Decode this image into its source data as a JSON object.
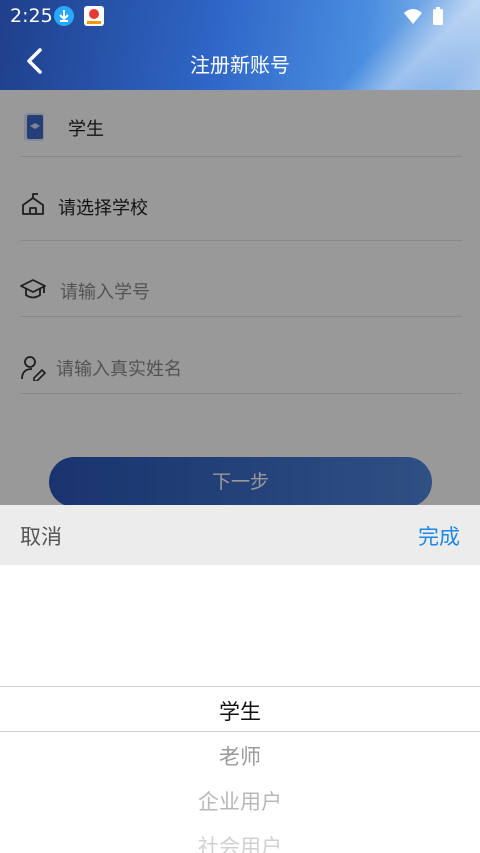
{
  "status": {
    "time": "2:25"
  },
  "header": {
    "title": "注册新账号"
  },
  "form": {
    "role_value": "学生",
    "school_placeholder": "请选择学校",
    "student_id_placeholder": "请输入学号",
    "name_placeholder": "请输入真实姓名",
    "next_label": "下一步"
  },
  "picker": {
    "cancel_label": "取消",
    "done_label": "完成",
    "options": [
      "学生",
      "老师",
      "企业用户",
      "社会用户"
    ],
    "selected": "学生"
  },
  "colors": {
    "accent": "#1e88e5",
    "header_start": "#1f3f8a",
    "header_end": "#4a8ee0",
    "button": "#2a56b8"
  }
}
